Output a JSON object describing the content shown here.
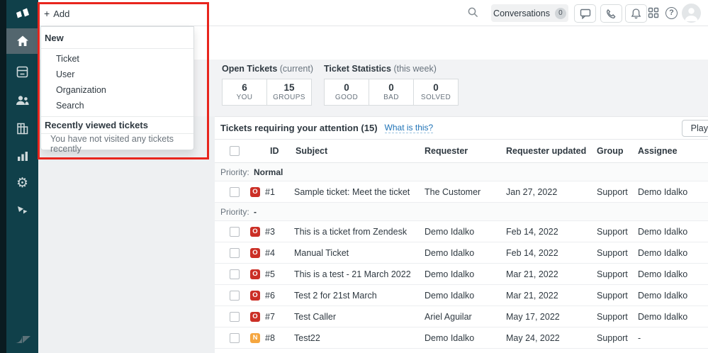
{
  "topbar": {
    "add_plus": "+",
    "add_label": "Add",
    "conversations_label": "Conversations",
    "conversations_count": "0",
    "help_glyph": "?",
    "icons": [
      "search-icon",
      "chat-icon",
      "phone-icon",
      "bell-icon",
      "apps-grid-icon",
      "help-icon",
      "avatar"
    ]
  },
  "sidebar": {
    "icons": [
      "brand-logo",
      "home-icon",
      "views-icon",
      "customers-icon",
      "organizations-icon",
      "reporting-icon",
      "admin-gear-icon",
      "apps-icon",
      "zendesk-logo"
    ],
    "active_item": "home"
  },
  "add_menu": {
    "section_new": "New",
    "items": [
      {
        "label": "Ticket"
      },
      {
        "label": "User"
      },
      {
        "label": "Organization"
      },
      {
        "label": "Search"
      }
    ],
    "section_recent": "Recently viewed tickets",
    "empty_message": "You have not visited any tickets recently"
  },
  "stats": {
    "open": {
      "title": "Open Tickets",
      "qualifier": "(current)",
      "boxes": [
        {
          "value": "6",
          "label": "YOU"
        },
        {
          "value": "15",
          "label": "GROUPS"
        }
      ]
    },
    "week": {
      "title": "Ticket Statistics",
      "qualifier": "(this week)",
      "boxes": [
        {
          "value": "0",
          "label": "GOOD"
        },
        {
          "value": "0",
          "label": "BAD"
        },
        {
          "value": "0",
          "label": "SOLVED"
        }
      ]
    }
  },
  "attention": {
    "title": "Tickets requiring your attention (15)",
    "link": "What is this?",
    "play_label": "Play"
  },
  "table": {
    "headers": {
      "id": "ID",
      "subject": "Subject",
      "requester": "Requester",
      "requester_updated": "Requester updated",
      "group": "Group",
      "assignee": "Assignee"
    },
    "groups": [
      {
        "prefix": "Priority:",
        "value": "Normal",
        "rows": [
          {
            "status": "O",
            "status_type": "open",
            "id": "#1",
            "subject": "Sample ticket: Meet the ticket",
            "requester": "The Customer",
            "updated": "Jan 27, 2022",
            "group": "Support",
            "assignee": "Demo Idalko"
          }
        ]
      },
      {
        "prefix": "Priority:",
        "value": "-",
        "rows": [
          {
            "status": "O",
            "status_type": "open",
            "id": "#3",
            "subject": "This is a ticket from Zendesk",
            "requester": "Demo Idalko",
            "updated": "Feb 14, 2022",
            "group": "Support",
            "assignee": "Demo Idalko"
          },
          {
            "status": "O",
            "status_type": "open",
            "id": "#4",
            "subject": "Manual Ticket",
            "requester": "Demo Idalko",
            "updated": "Feb 14, 2022",
            "group": "Support",
            "assignee": "Demo Idalko"
          },
          {
            "status": "O",
            "status_type": "open",
            "id": "#5",
            "subject": "This is a test - 21 March 2022",
            "requester": "Demo Idalko",
            "updated": "Mar 21, 2022",
            "group": "Support",
            "assignee": "Demo Idalko"
          },
          {
            "status": "O",
            "status_type": "open",
            "id": "#6",
            "subject": "Test 2 for 21st March",
            "requester": "Demo Idalko",
            "updated": "Mar 21, 2022",
            "group": "Support",
            "assignee": "Demo Idalko"
          },
          {
            "status": "O",
            "status_type": "open",
            "id": "#7",
            "subject": "Test Caller",
            "requester": "Ariel Aguilar",
            "updated": "May 17, 2022",
            "group": "Support",
            "assignee": "Demo Idalko"
          },
          {
            "status": "N",
            "status_type": "new",
            "id": "#8",
            "subject": "Test22",
            "requester": "Demo Idalko",
            "updated": "May 24, 2022",
            "group": "Support",
            "assignee": "-"
          }
        ]
      }
    ]
  },
  "colors": {
    "annotation_red": "#e8251d",
    "badge_open": "#cb2f26",
    "badge_new": "#f5a63f",
    "link_blue": "#1f73b7",
    "sidebar_teal": "#10404a"
  }
}
